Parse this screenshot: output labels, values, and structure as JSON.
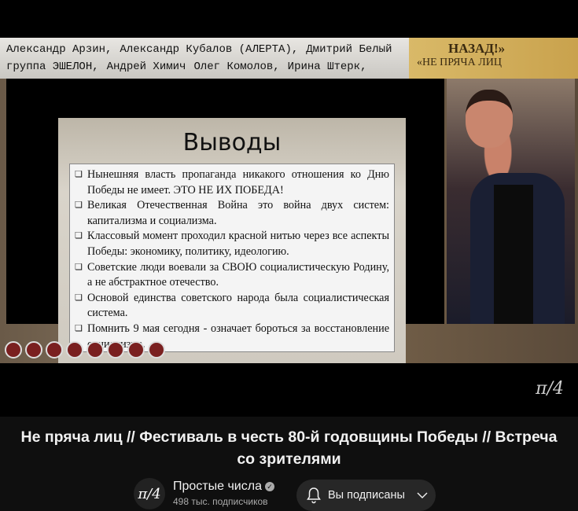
{
  "video": {
    "names_line1": [
      "Александр Арзин,",
      "Александр Кубалов (АЛЕРТА),",
      "Дмитрий Белый"
    ],
    "names_line2": [
      "группа ЭШЕЛОН,",
      "Андрей Химич",
      "Олег Комолов,",
      "Ирина Штерк,"
    ],
    "stamp_line1": "НАЗАД!»",
    "stamp_line2": "«НЕ ПРЯЧА ЛИЦ",
    "slide_title": "Выводы",
    "slide_bullets": [
      "Нынешняя власть пропаганда никакого отношения ко Дню Победы не имеет. ЭТО НЕ ИХ ПОБЕДА!",
      "Великая Отечественная Война это война двух систем: капитализма и социализма.",
      "Классовый момент проходил красной нитью через все аспекты Победы: экономику, политику, идеологию.",
      "Советские люди воевали за СВОЮ социалистическую Родину, а не абстрактное отечество.",
      "Основой единства советского народа была социалистическая система.",
      "Помнить 9 мая сегодня - означает бороться за восстановление социализма."
    ],
    "watermark": "π/4"
  },
  "title": "Не пряча лиц // Фестиваль в честь 80-й годовщины Победы // Встреча со зрителями",
  "channel": {
    "avatar_text": "π/4",
    "name": "Простые числа",
    "subscribers": "498 тыс. подписчиков",
    "subscribe_label": "Вы подписаны"
  }
}
